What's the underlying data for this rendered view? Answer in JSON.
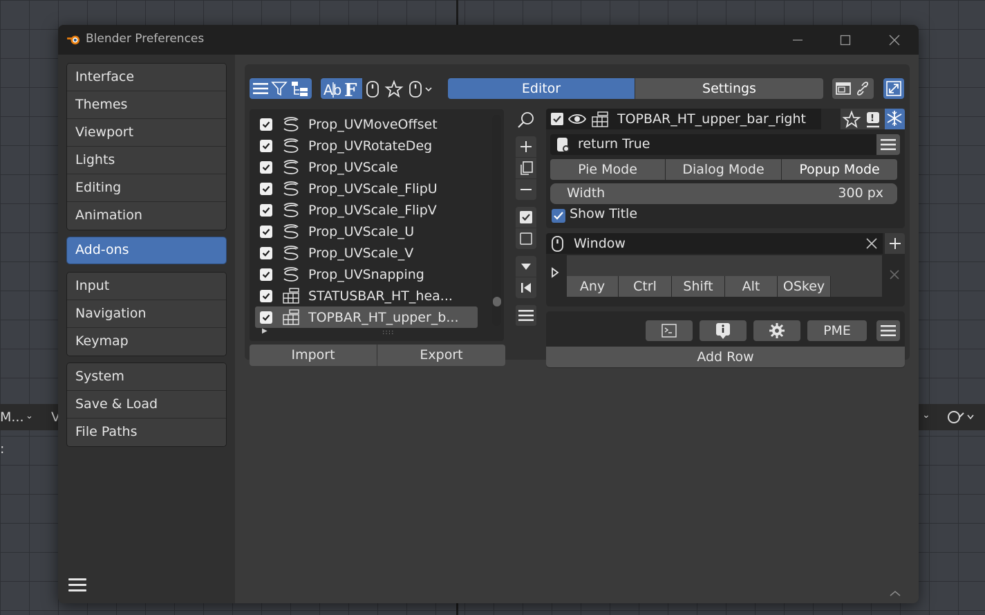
{
  "window": {
    "title": "Blender Preferences",
    "controls": [
      "minimize-icon",
      "maximize-icon",
      "close-icon"
    ]
  },
  "background": {
    "left_dropdown": "M...",
    "left_letter": "V",
    "left_colon": ":"
  },
  "sidebar": {
    "groups": [
      [
        "Interface",
        "Themes",
        "Viewport",
        "Lights",
        "Editing",
        "Animation"
      ],
      [
        "Add-ons"
      ],
      [
        "Input",
        "Navigation",
        "Keymap"
      ],
      [
        "System",
        "Save & Load",
        "File Paths"
      ]
    ],
    "active": "Add-ons"
  },
  "toolbar": {
    "tabs": [
      "Editor",
      "Settings"
    ],
    "active_tab": "Editor"
  },
  "item_list": {
    "items": [
      {
        "label": "Prop_UVMoveOffset",
        "checked": true,
        "icon": "spiral-icon"
      },
      {
        "label": "Prop_UVRotateDeg",
        "checked": true,
        "icon": "spiral-icon"
      },
      {
        "label": "Prop_UVScale",
        "checked": true,
        "icon": "spiral-icon"
      },
      {
        "label": "Prop_UVScale_FlipU",
        "checked": true,
        "icon": "spiral-icon"
      },
      {
        "label": "Prop_UVScale_FlipV",
        "checked": true,
        "icon": "spiral-icon"
      },
      {
        "label": "Prop_UVScale_U",
        "checked": true,
        "icon": "spiral-icon"
      },
      {
        "label": "Prop_UVScale_V",
        "checked": true,
        "icon": "spiral-icon"
      },
      {
        "label": "Prop_UVSnapping",
        "checked": true,
        "icon": "spiral-icon"
      },
      {
        "label": "STATUSBAR_HT_hea...",
        "checked": true,
        "icon": "grid-icon"
      },
      {
        "label": "TOPBAR_HT_upper_b...",
        "checked": true,
        "icon": "grid-icon",
        "selected": true
      }
    ],
    "import_label": "Import",
    "export_label": "Export"
  },
  "editor": {
    "name": "TOPBAR_HT_upper_bar_right",
    "poll": "return True",
    "modes": [
      "Pie Mode",
      "Dialog Mode",
      "Popup Mode"
    ],
    "active_mode": "Popup Mode",
    "width_label": "Width",
    "width_value": "300 px",
    "show_title_label": "Show Title",
    "show_title": true,
    "keymap_name": "Window",
    "modifiers": [
      "Any",
      "Ctrl",
      "Shift",
      "Alt",
      "OSkey"
    ],
    "pme_label": "PME",
    "add_row_label": "Add Row"
  },
  "colors": {
    "accent": "#4772b3",
    "window_bg": "#303030",
    "button": "#545454"
  }
}
